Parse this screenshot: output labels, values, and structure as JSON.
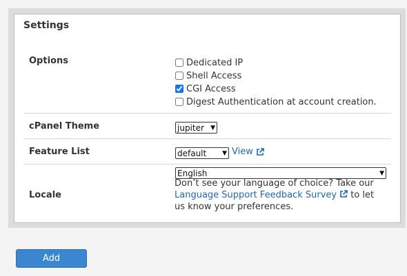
{
  "panel": {
    "title": "Settings"
  },
  "options": {
    "label": "Options",
    "checkboxes": [
      {
        "label": "Dedicated IP",
        "checked": false
      },
      {
        "label": "Shell Access",
        "checked": false
      },
      {
        "label": "CGI Access",
        "checked": true
      },
      {
        "label": "Digest Authentication at account creation.",
        "checked": false
      }
    ]
  },
  "theme": {
    "label": "cPanel Theme",
    "selected": "jupiter"
  },
  "feature_list": {
    "label": "Feature List",
    "selected": "default",
    "view_link": "View"
  },
  "locale": {
    "label": "Locale",
    "selected": "English",
    "text_before": "Don’t see your language of choice? Take our",
    "survey_link": "Language Support Feedback Survey",
    "text_after": "to let us know your preferences."
  },
  "actions": {
    "add_label": "Add"
  },
  "colors": {
    "link": "#1b6bb3",
    "button_bg": "#3a87d0"
  }
}
